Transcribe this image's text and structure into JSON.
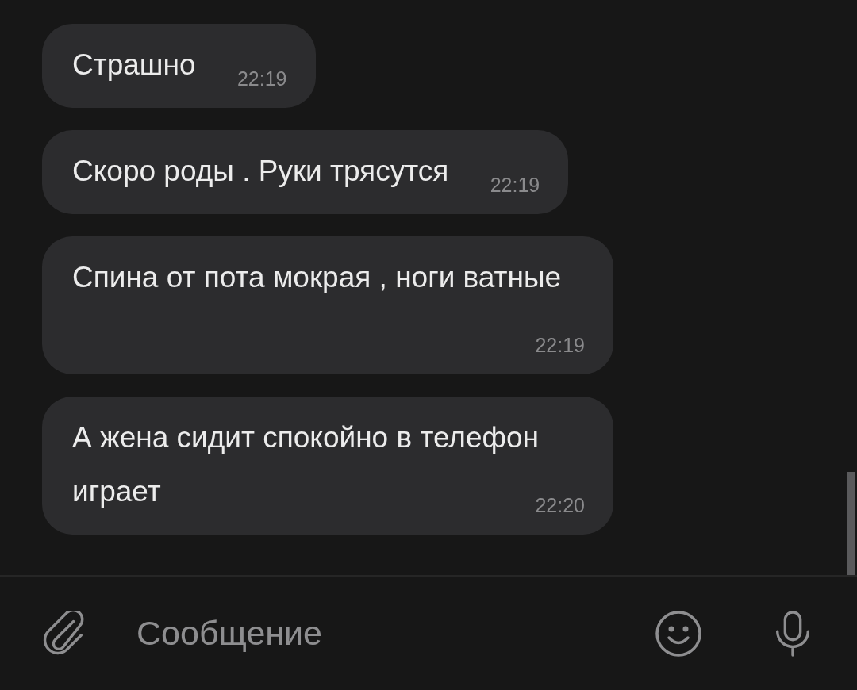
{
  "messages": [
    {
      "text": "Страшно",
      "time": "22:19"
    },
    {
      "text": "Скоро роды . Руки трясутся",
      "time": "22:19"
    },
    {
      "text": "Спина от пота мокрая , ноги ватные",
      "time": "22:19"
    },
    {
      "text": "А жена сидит спокойно в телефон играет",
      "time": "22:20"
    }
  ],
  "composer": {
    "placeholder": "Сообщение"
  }
}
